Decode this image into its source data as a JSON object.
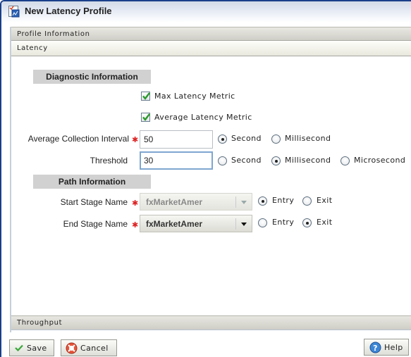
{
  "window": {
    "title": "New Latency Profile",
    "icon": "profile-icon"
  },
  "panels": {
    "profile_information": "Profile Information",
    "latency": "Latency",
    "throughput": "Throughput"
  },
  "diagnostic": {
    "section_title": "Diagnostic Information",
    "max_latency": {
      "label": "Max Latency Metric",
      "checked": true
    },
    "avg_latency": {
      "label": "Average Latency Metric",
      "checked": true
    },
    "avg_collection_interval": {
      "label": "Average Collection Interval",
      "required": true,
      "value": "50",
      "units": [
        "Second",
        "Millisecond"
      ],
      "selected_unit": "Second"
    },
    "threshold": {
      "label": "Threshold",
      "value": "30",
      "units": [
        "Second",
        "Millisecond",
        "Microsecond"
      ],
      "selected_unit": "Millisecond"
    }
  },
  "path": {
    "section_title": "Path Information",
    "start_stage": {
      "label": "Start Stage Name",
      "required": true,
      "value": "fxMarketAmer",
      "enabled": false,
      "options": [
        "Entry",
        "Exit"
      ],
      "selected": "Entry"
    },
    "end_stage": {
      "label": "End Stage Name",
      "required": true,
      "value": "fxMarketAmer",
      "enabled": true,
      "options": [
        "Entry",
        "Exit"
      ],
      "selected": "Exit"
    }
  },
  "required_marker": "✱",
  "footer": {
    "save_label": "Save",
    "cancel_label": "Cancel",
    "help_label": "Help"
  }
}
